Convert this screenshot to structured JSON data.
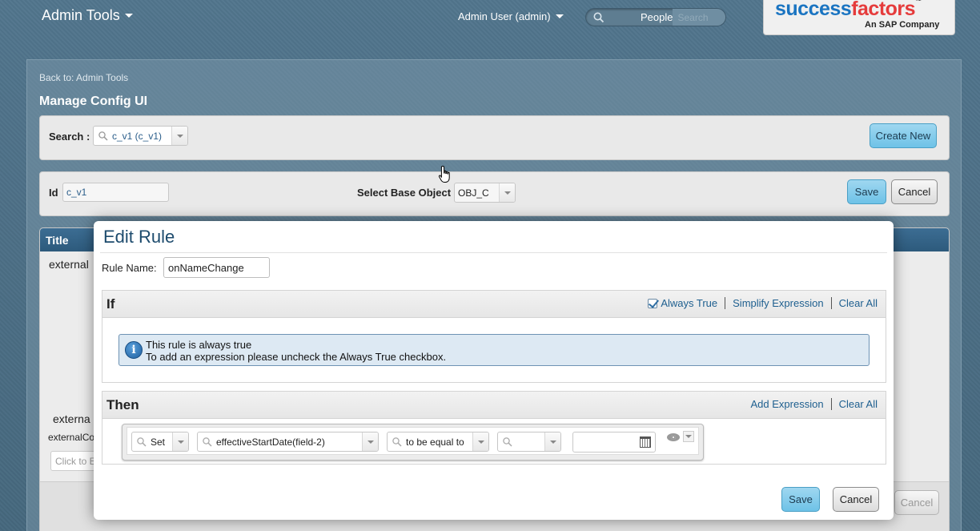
{
  "header": {
    "admin_tools": "Admin Tools",
    "user_menu": "Admin User (admin)",
    "people_label": "People",
    "search_placeholder": "Search",
    "logo_main_a": "success",
    "logo_main_b": "factors",
    "logo_tm": "™",
    "logo_sub": "An SAP Company"
  },
  "page": {
    "back_link": "Back to: Admin Tools",
    "title": "Manage Config UI",
    "search_label": "Search :",
    "search_value": "c_v1 (c_v1)",
    "create_new": "Create New",
    "id_label": "Id",
    "id_value": "c_v1",
    "base_object_label": "Select Base Object",
    "base_object_value": "OBJ_C",
    "save": "Save",
    "cancel": "Cancel",
    "table_title_col": "Title",
    "bg_text_1": "external",
    "bg_text_2": "externa",
    "bg_text_3": "externalCo",
    "bg_input_placeholder": "Click to E",
    "bg_cancel": "Cancel"
  },
  "modal": {
    "title": "Edit Rule",
    "rule_name_label": "Rule Name:",
    "rule_name_value": "onNameChange",
    "if_section": {
      "title": "If",
      "always_true": "Always True",
      "always_true_checked": true,
      "simplify": "Simplify Expression",
      "clear_all": "Clear All",
      "info_line1": "This rule is always true",
      "info_line2": "To add an expression please uncheck the Always True checkbox."
    },
    "then_section": {
      "title": "Then",
      "add_expression": "Add Expression",
      "clear_all": "Clear All",
      "action": "Set",
      "field": "effectiveStartDate(field-2)",
      "operator": "to be equal to",
      "value": "",
      "date_value": ""
    },
    "save": "Save",
    "cancel": "Cancel"
  },
  "colors": {
    "accent_button": "#6ec2e7",
    "header_blue": "#2d5a7c",
    "link_blue": "#1e5f8f",
    "logo_blue": "#1a74c1",
    "logo_red": "#e53b3b"
  }
}
